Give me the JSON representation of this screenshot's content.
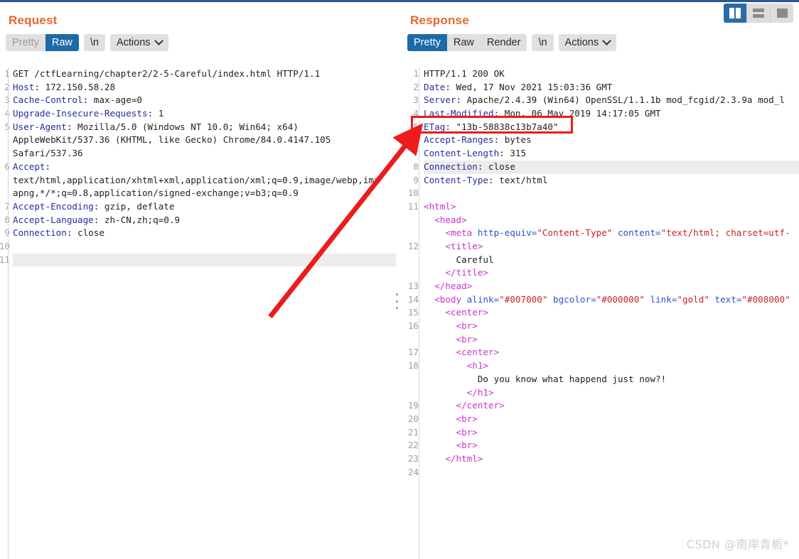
{
  "window": {
    "accent_color": "#2b5797",
    "title_color": "#e8662b"
  },
  "layout_switcher": {
    "buttons": [
      {
        "name": "side-by-side",
        "icon": "columns-icon",
        "active": true
      },
      {
        "name": "stacked",
        "icon": "rows-icon",
        "active": false
      },
      {
        "name": "single",
        "icon": "square-icon",
        "active": false
      }
    ]
  },
  "request": {
    "title": "Request",
    "tabs": [
      {
        "label": "Pretty",
        "state": "disabled"
      },
      {
        "label": "Raw",
        "state": "selected"
      }
    ],
    "newline_label": "\\n",
    "actions_label": "Actions",
    "lines": [
      {
        "num": "1",
        "segments": [
          {
            "t": "GET /ctfLearning/chapter2/2-5-Careful/index.html HTTP/1.1",
            "c": "v"
          }
        ]
      },
      {
        "num": "2",
        "segments": [
          {
            "t": "Host",
            "c": "k"
          },
          {
            "t": ": 172.150.58.28",
            "c": "v"
          }
        ]
      },
      {
        "num": "3",
        "segments": [
          {
            "t": "Cache-Control",
            "c": "k"
          },
          {
            "t": ": max-age=0",
            "c": "v"
          }
        ]
      },
      {
        "num": "4",
        "segments": [
          {
            "t": "Upgrade-Insecure-Requests",
            "c": "k"
          },
          {
            "t": ": 1",
            "c": "v"
          }
        ]
      },
      {
        "num": "5",
        "segments": [
          {
            "t": "User-Agent",
            "c": "k"
          },
          {
            "t": ": Mozilla/5.0 (Windows NT 10.0; Win64; x64)",
            "c": "v"
          }
        ]
      },
      {
        "num": "",
        "segments": [
          {
            "t": "AppleWebKit/537.36 (KHTML, like Gecko) Chrome/84.0.4147.105",
            "c": "v"
          }
        ]
      },
      {
        "num": "",
        "segments": [
          {
            "t": "Safari/537.36",
            "c": "v"
          }
        ]
      },
      {
        "num": "6",
        "segments": [
          {
            "t": "Accept",
            "c": "k"
          },
          {
            "t": ":",
            "c": "v"
          }
        ]
      },
      {
        "num": "",
        "segments": [
          {
            "t": "text/html,application/xhtml+xml,application/xml;q=0.9,image/webp,ima",
            "c": "v"
          }
        ]
      },
      {
        "num": "",
        "segments": [
          {
            "t": "apng,*/*;q=0.8,application/signed-exchange;v=b3;q=0.9",
            "c": "v"
          }
        ]
      },
      {
        "num": "7",
        "segments": [
          {
            "t": "Accept-Encoding",
            "c": "k"
          },
          {
            "t": ": gzip, deflate",
            "c": "v"
          }
        ]
      },
      {
        "num": "8",
        "segments": [
          {
            "t": "Accept-Language",
            "c": "k"
          },
          {
            "t": ": zh-CN,zh;q=0.9",
            "c": "v"
          }
        ]
      },
      {
        "num": "9",
        "segments": [
          {
            "t": "Connection",
            "c": "k"
          },
          {
            "t": ": close",
            "c": "v"
          }
        ]
      },
      {
        "num": "10",
        "segments": []
      },
      {
        "num": "11",
        "segments": [],
        "highlight": true
      }
    ]
  },
  "response": {
    "title": "Response",
    "tabs": [
      {
        "label": "Pretty",
        "state": "selected"
      },
      {
        "label": "Raw",
        "state": "normal"
      },
      {
        "label": "Render",
        "state": "normal"
      }
    ],
    "newline_label": "\\n",
    "actions_label": "Actions",
    "lines": [
      {
        "num": "1",
        "segments": [
          {
            "t": "HTTP/1.1 200 OK",
            "c": "v"
          }
        ]
      },
      {
        "num": "2",
        "segments": [
          {
            "t": "Date",
            "c": "k"
          },
          {
            "t": ": Wed, 17 Nov 2021 15:03:36 GMT",
            "c": "v"
          }
        ]
      },
      {
        "num": "3",
        "segments": [
          {
            "t": "Server",
            "c": "k"
          },
          {
            "t": ": Apache/2.4.39 (Win64) OpenSSL/1.1.1b mod_fcgid/2.3.9a mod_l",
            "c": "v"
          }
        ]
      },
      {
        "num": "4",
        "segments": [
          {
            "t": "Last-Modified",
            "c": "k"
          },
          {
            "t": ": Mon, 06 May 2019 14:17:05 GMT",
            "c": "v"
          }
        ]
      },
      {
        "num": "5",
        "segments": [
          {
            "t": "ETag",
            "c": "k"
          },
          {
            "t": ": \"13b-58838c13b7a40\"",
            "c": "v"
          }
        ]
      },
      {
        "num": "6",
        "segments": [
          {
            "t": "Accept-Ranges",
            "c": "k"
          },
          {
            "t": ": bytes",
            "c": "v"
          }
        ]
      },
      {
        "num": "7",
        "segments": [
          {
            "t": "Content-Length",
            "c": "k"
          },
          {
            "t": ": 315",
            "c": "v"
          }
        ]
      },
      {
        "num": "8",
        "segments": [
          {
            "t": "Connection",
            "c": "k"
          },
          {
            "t": ": close",
            "c": "v"
          }
        ],
        "highlight": true
      },
      {
        "num": "9",
        "segments": [
          {
            "t": "Content-Type",
            "c": "k"
          },
          {
            "t": ": text/html",
            "c": "v"
          }
        ]
      },
      {
        "num": "10",
        "segments": []
      },
      {
        "num": "11",
        "segments": [
          {
            "t": "<html>",
            "c": "tag"
          }
        ]
      },
      {
        "num": "",
        "segments": [
          {
            "t": "  <head>",
            "c": "tag"
          }
        ]
      },
      {
        "num": "",
        "segments": [
          {
            "t": "    <meta ",
            "c": "tag"
          },
          {
            "t": "http-equiv=",
            "c": "att"
          },
          {
            "t": "\"Content-Type\"",
            "c": "str"
          },
          {
            "t": " content=",
            "c": "att"
          },
          {
            "t": "\"text/html; charset=utf-",
            "c": "str"
          }
        ]
      },
      {
        "num": "12",
        "segments": [
          {
            "t": "    <title>",
            "c": "tag"
          }
        ]
      },
      {
        "num": "",
        "segments": [
          {
            "t": "      Careful",
            "c": "v"
          }
        ]
      },
      {
        "num": "",
        "segments": [
          {
            "t": "    </title>",
            "c": "tag"
          }
        ]
      },
      {
        "num": "13",
        "segments": [
          {
            "t": "  </head>",
            "c": "tag"
          }
        ]
      },
      {
        "num": "14",
        "segments": [
          {
            "t": "  <body ",
            "c": "tag"
          },
          {
            "t": "alink=",
            "c": "att"
          },
          {
            "t": "\"#007000\"",
            "c": "str"
          },
          {
            "t": " bgcolor=",
            "c": "att"
          },
          {
            "t": "\"#000000\"",
            "c": "str"
          },
          {
            "t": " link=",
            "c": "att"
          },
          {
            "t": "\"gold\"",
            "c": "str"
          },
          {
            "t": " text=",
            "c": "att"
          },
          {
            "t": "\"#008000\"",
            "c": "str"
          }
        ]
      },
      {
        "num": "15",
        "segments": [
          {
            "t": "    <center>",
            "c": "tag"
          }
        ]
      },
      {
        "num": "16",
        "segments": [
          {
            "t": "      <br>",
            "c": "tag"
          }
        ]
      },
      {
        "num": "",
        "segments": [
          {
            "t": "      <br>",
            "c": "tag"
          }
        ]
      },
      {
        "num": "17",
        "segments": [
          {
            "t": "      <center>",
            "c": "tag"
          }
        ]
      },
      {
        "num": "18",
        "segments": [
          {
            "t": "        <h1>",
            "c": "tag"
          }
        ]
      },
      {
        "num": "",
        "segments": [
          {
            "t": "          Do you know what happend just now?!",
            "c": "v"
          }
        ]
      },
      {
        "num": "",
        "segments": [
          {
            "t": "        </h1>",
            "c": "tag"
          }
        ]
      },
      {
        "num": "19",
        "segments": [
          {
            "t": "      </center>",
            "c": "tag"
          }
        ]
      },
      {
        "num": "20",
        "segments": [
          {
            "t": "      <br>",
            "c": "tag"
          }
        ]
      },
      {
        "num": "21",
        "segments": [
          {
            "t": "      <br>",
            "c": "tag"
          }
        ]
      },
      {
        "num": "22",
        "segments": [
          {
            "t": "      <br>",
            "c": "tag"
          }
        ]
      },
      {
        "num": "23",
        "segments": [
          {
            "t": "    </html>",
            "c": "tag"
          }
        ]
      },
      {
        "num": "24",
        "segments": []
      }
    ]
  },
  "annotations": {
    "etag_highlight_color": "#ee1b1b",
    "arrow_color": "#ee1b1b"
  },
  "watermark": "CSDN @南岸青栀*"
}
